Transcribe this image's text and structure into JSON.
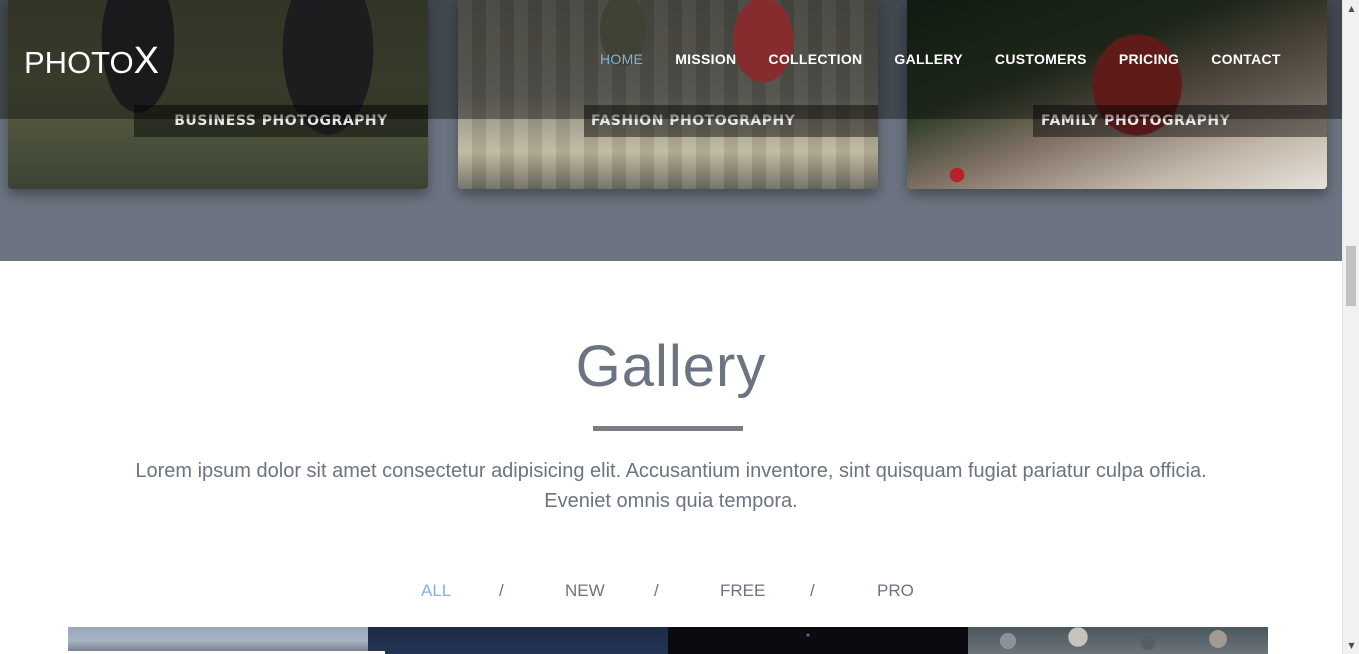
{
  "brand": {
    "logo_text": "PHOTO",
    "logo_accent": "X"
  },
  "nav": {
    "items": [
      "HOME",
      "MISSION",
      "COLLECTION",
      "GALLERY",
      "CUSTOMERS",
      "PRICING",
      "CONTACT"
    ],
    "active": "HOME"
  },
  "cards": [
    {
      "label": "BUSINESS PHOTOGRAPHY"
    },
    {
      "label": "FASHION PHOTOGRAPHY"
    },
    {
      "label": "FAMILY PHOTOGRAPHY"
    }
  ],
  "gallery": {
    "title": "Gallery",
    "description_line1": "Lorem ipsum dolor sit amet consectetur adipisicing elit. Accusantium inventore, sint quisquam fugiat pariatur culpa officia.",
    "description_line2": "Eveniet omnis quia tempora.",
    "filters": [
      "ALL",
      "NEW",
      "FREE",
      "PRO"
    ],
    "active_filter": "ALL",
    "separator": "/"
  },
  "colors": {
    "accent": "#7fb2d8",
    "text_gray": "#6b7480",
    "band_bg": "#6b7480"
  },
  "icons": {
    "scroll_up": "scroll-up-arrow-icon",
    "scroll_down": "scroll-down-arrow-icon"
  }
}
